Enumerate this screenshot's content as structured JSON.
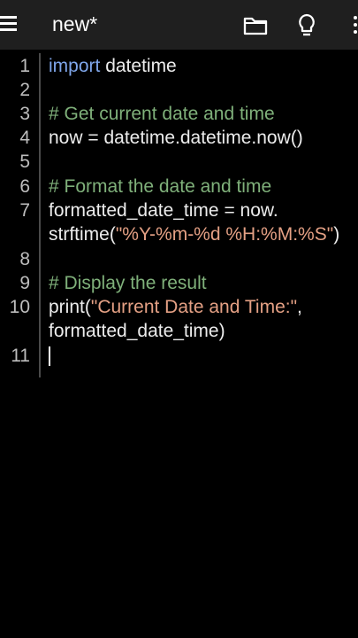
{
  "header": {
    "title": "new*",
    "icons": [
      "menu-icon",
      "folder-icon",
      "lightbulb-icon",
      "more-vertical-icon"
    ]
  },
  "editor": {
    "line_numbers": [
      "1",
      "2",
      "3",
      "4",
      "5",
      "6",
      "7",
      "8",
      "9",
      "10",
      "11"
    ],
    "line1_kw": "import",
    "line1_rest": " datetime",
    "line3": "# Get current date and time",
    "line4": "now = datetime.datetime.now()",
    "line6": "# Format the date and time",
    "line7a": "formatted_date_time = now.",
    "line7b_pre": "strftime(",
    "line7b_str": "\"%Y-%m-%d %H:%M:%S\"",
    "line7b_post": ")",
    "line9": "# Display the result",
    "line10a_pre": "print(",
    "line10a_str": "\"Current Date and Time:\"",
    "line10a_post": ",",
    "line10b": "formatted_date_time)"
  },
  "colors": {
    "keyword": "#7fa6ea",
    "comment": "#7fb07a",
    "string": "#e4a084",
    "background": "#000000",
    "toolbar": "#1f1f1f"
  }
}
